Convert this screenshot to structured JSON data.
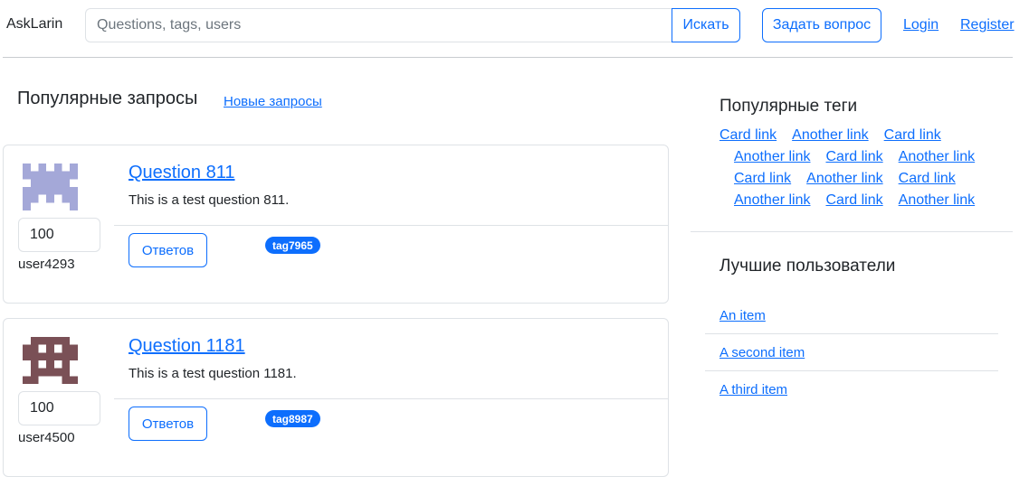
{
  "header": {
    "brand": "AskLarin",
    "search_placeholder": "Questions, tags, users",
    "search_button": "Искать",
    "ask_button": "Задать вопрос",
    "login": "Login",
    "register": "Register"
  },
  "main": {
    "title": "Популярные запросы",
    "new_link": "Новые запросы",
    "questions": [
      {
        "title": "Question 811",
        "text": "This is a test question 811.",
        "rating": "100",
        "user": "user4293",
        "answers_button": "Ответов",
        "tag": "tag7965",
        "avatar_color": "#a4a8d8"
      },
      {
        "title": "Question 1181",
        "text": "This is a test question 1181.",
        "rating": "100",
        "user": "user4500",
        "answers_button": "Ответов",
        "tag": "tag8987",
        "avatar_color": "#7a5056"
      }
    ]
  },
  "sidebar": {
    "tags_title": "Популярные теги",
    "tags": [
      [
        "Card link",
        "Another link",
        "Card link"
      ],
      [
        "Another link",
        "Card link",
        "Another link"
      ],
      [
        "Card link",
        "Another link",
        "Card link"
      ],
      [
        "Another link",
        "Card link",
        "Another link"
      ]
    ],
    "users_title": "Лучшие пользователи",
    "users": [
      "An item",
      "A second item",
      "A third item"
    ]
  },
  "colors": {
    "accent": "#0d6efd",
    "border": "#dee2e6"
  }
}
